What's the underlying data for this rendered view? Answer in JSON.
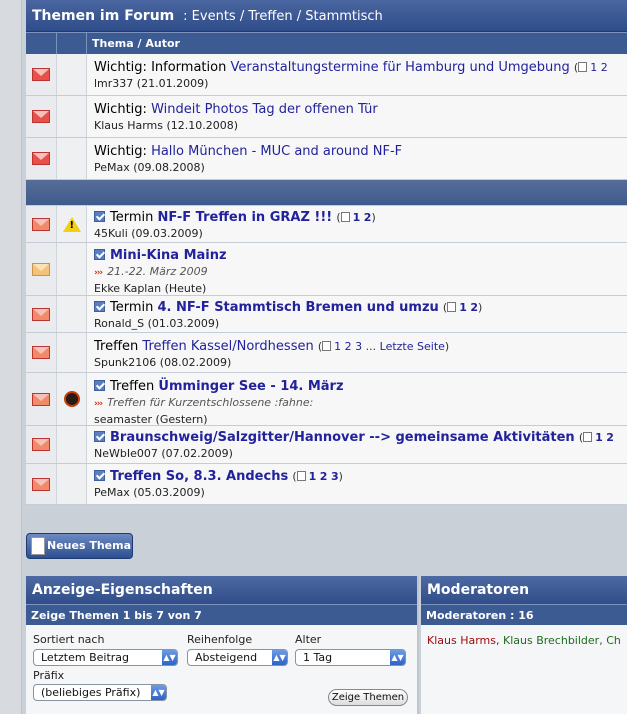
{
  "header": {
    "title": "Themen im Forum",
    "breadcrumb": ": Events / Treffen / Stammtisch",
    "column_header": "Thema / Autor"
  },
  "sticky_threads": [
    {
      "prefix": "Wichtig:",
      "prefix2": "Information",
      "title": "Veranstaltungstermine für Hamburg und Umgebung",
      "pages": [
        "1",
        "2"
      ],
      "author": "lmr337",
      "date": "(21.01.2009)",
      "icon": "envelope-hot-icon"
    },
    {
      "prefix": "Wichtig:",
      "prefix2": "",
      "title": "Windeit Photos Tag der offenen Tür",
      "pages": [],
      "author": "Klaus Harms",
      "date": "(12.10.2008)",
      "icon": "envelope-hot-icon"
    },
    {
      "prefix": "Wichtig:",
      "prefix2": "",
      "title": "Hallo München - MUC and around NF-F",
      "pages": [],
      "author": "PeMax",
      "date": "(09.08.2008)",
      "icon": "envelope-hot-icon"
    }
  ],
  "threads": [
    {
      "prefix": "Termin",
      "title": "NF-F Treffen in GRAZ !!!",
      "pages": [
        "1",
        "2"
      ],
      "author": "45Kuli",
      "date": "(09.03.2009)",
      "badge": "warning-icon",
      "subtitle": ""
    },
    {
      "prefix": "",
      "title": "Mini-Kina Mainz",
      "pages": [],
      "author": "Ekke Kaplan",
      "date": "(Heute)",
      "badge": "",
      "subtitle": "21.-22. März 2009"
    },
    {
      "prefix": "Termin",
      "title": "4. NF-F Stammtisch Bremen und umzu",
      "pages": [
        "1",
        "2"
      ],
      "author": "Ronald_S",
      "date": "(01.03.2009)",
      "badge": "",
      "subtitle": ""
    },
    {
      "prefix": "Treffen",
      "title": "Treffen Kassel/Nordhessen",
      "pages": [
        "1",
        "2",
        "3"
      ],
      "pages_more": "...",
      "pages_last": "Letzte Seite",
      "author": "Spunk2106",
      "date": "(08.02.2009)",
      "badge": "",
      "subtitle": ""
    },
    {
      "prefix": "Treffen",
      "title": "Ümminger See - 14. März",
      "pages": [],
      "author": "seamaster",
      "date": "(Gestern)",
      "badge": "devil-icon",
      "subtitle": "Treffen für Kurzentschlossene :fahne:"
    },
    {
      "prefix": "",
      "title": "Braunschweig/Salzgitter/Hannover --> gemeinsame Aktivitäten",
      "pages": [
        "1",
        "2"
      ],
      "author": "NeWbIe007",
      "date": "(07.02.2009)",
      "badge": "",
      "subtitle": ""
    },
    {
      "prefix": "",
      "title": "Treffen So, 8.3. Andechs",
      "pages": [
        "1",
        "2",
        "3"
      ],
      "author": "PeMax",
      "date": "(05.03.2009)",
      "badge": "",
      "subtitle": ""
    }
  ],
  "new_thread_button": "Neues Thema",
  "display_panel": {
    "title": "Anzeige-Eigenschaften",
    "subtitle": "Zeige Themen 1 bis 7 von 7",
    "sort_label": "Sortiert nach",
    "sort_value": "Letztem Beitrag",
    "order_label": "Reihenfolge",
    "order_value": "Absteigend",
    "age_label": "Alter",
    "age_value": "1 Tag",
    "prefix_label": "Präfix",
    "prefix_value": "(beliebiges Präfix)",
    "submit": "Zeige Themen"
  },
  "moderators_panel": {
    "title": "Moderatoren",
    "subtitle": "Moderatoren : 16",
    "mod1": "Klaus Harms,",
    "mod2": "Klaus Brechbilder,",
    "mod3": "Ch"
  },
  "colors": {
    "header_blue": "#3b5998",
    "link": "#22229c",
    "moderator_red": "#9b0a0a",
    "moderator_green": "#1d6b1d"
  }
}
